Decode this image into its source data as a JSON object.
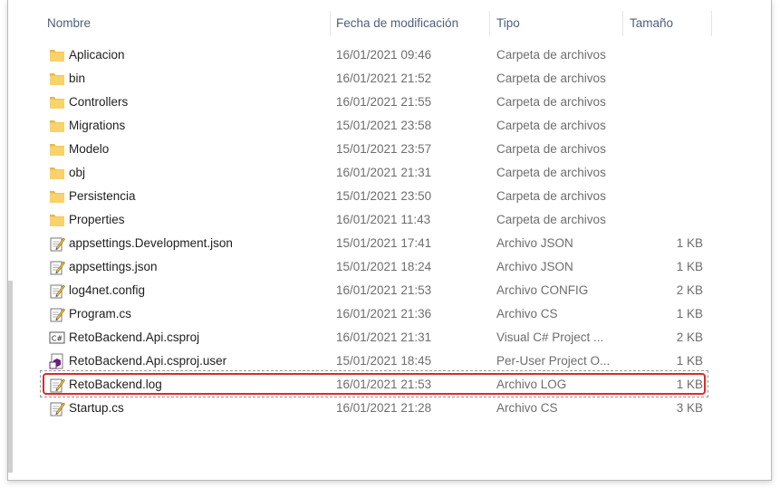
{
  "columns": {
    "name": "Nombre",
    "date": "Fecha de modificación",
    "type": "Tipo",
    "size": "Tamaño"
  },
  "files": [
    {
      "name": "Aplicacion",
      "date": "16/01/2021 09:46",
      "type": "Carpeta de archivos",
      "size": "",
      "icon": "folder-icon"
    },
    {
      "name": "bin",
      "date": "16/01/2021 21:52",
      "type": "Carpeta de archivos",
      "size": "",
      "icon": "folder-icon"
    },
    {
      "name": "Controllers",
      "date": "16/01/2021 21:55",
      "type": "Carpeta de archivos",
      "size": "",
      "icon": "folder-icon"
    },
    {
      "name": "Migrations",
      "date": "15/01/2021 23:58",
      "type": "Carpeta de archivos",
      "size": "",
      "icon": "folder-icon"
    },
    {
      "name": "Modelo",
      "date": "15/01/2021 23:57",
      "type": "Carpeta de archivos",
      "size": "",
      "icon": "folder-icon"
    },
    {
      "name": "obj",
      "date": "16/01/2021 21:31",
      "type": "Carpeta de archivos",
      "size": "",
      "icon": "folder-icon"
    },
    {
      "name": "Persistencia",
      "date": "15/01/2021 23:50",
      "type": "Carpeta de archivos",
      "size": "",
      "icon": "folder-icon"
    },
    {
      "name": "Properties",
      "date": "16/01/2021 11:43",
      "type": "Carpeta de archivos",
      "size": "",
      "icon": "folder-icon"
    },
    {
      "name": "appsettings.Development.json",
      "date": "15/01/2021 17:41",
      "type": "Archivo JSON",
      "size": "1 KB",
      "icon": "text-file-icon"
    },
    {
      "name": "appsettings.json",
      "date": "15/01/2021 18:24",
      "type": "Archivo JSON",
      "size": "1 KB",
      "icon": "text-file-icon"
    },
    {
      "name": "log4net.config",
      "date": "16/01/2021 21:53",
      "type": "Archivo CONFIG",
      "size": "2 KB",
      "icon": "text-file-icon"
    },
    {
      "name": "Program.cs",
      "date": "16/01/2021 21:36",
      "type": "Archivo CS",
      "size": "1 KB",
      "icon": "text-file-icon"
    },
    {
      "name": "RetoBackend.Api.csproj",
      "date": "16/01/2021 21:31",
      "type": "Visual C# Project ...",
      "size": "2 KB",
      "icon": "csharp-project-icon"
    },
    {
      "name": "RetoBackend.Api.csproj.user",
      "date": "15/01/2021 18:45",
      "type": "Per-User Project O...",
      "size": "1 KB",
      "icon": "vs-user-file-icon"
    },
    {
      "name": "RetoBackend.log",
      "date": "16/01/2021 21:53",
      "type": "Archivo LOG",
      "size": "1 KB",
      "icon": "text-file-icon"
    },
    {
      "name": "Startup.cs",
      "date": "16/01/2021 21:28",
      "type": "Archivo CS",
      "size": "3 KB",
      "icon": "text-file-icon"
    }
  ],
  "highlighted_file": "RetoBackend.log",
  "colors": {
    "folder": "#f8d26a",
    "highlight_border": "#e02929",
    "header_text": "#4c607a"
  }
}
